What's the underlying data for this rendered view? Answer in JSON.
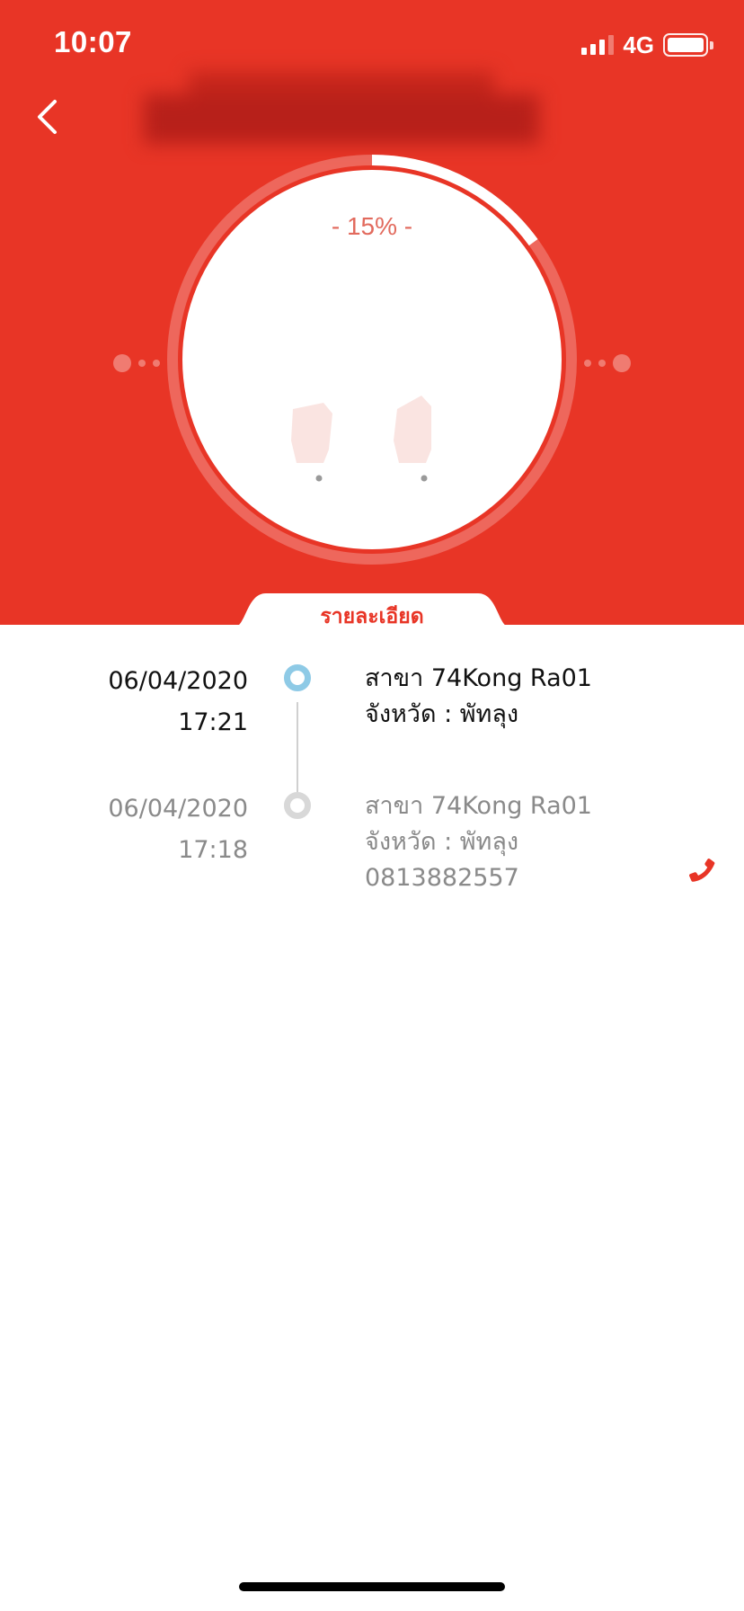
{
  "status_bar": {
    "time": "10:07",
    "network": "4G"
  },
  "header": {
    "background": "#e83526",
    "back_icon": "chevron-left-icon",
    "title_redacted": true
  },
  "progress": {
    "label": "- 15% -",
    "percent": 15,
    "track_color": "rgba(255,255,255,0.25)",
    "fill_color": "#ffffff"
  },
  "details_tab": {
    "label": "รายละเอียด"
  },
  "timeline": [
    {
      "date": "06/04/2020",
      "time": "17:21",
      "branch": "สาขา 74Kong Ra01",
      "province": "จังหวัด : พัทลุง",
      "phone": "",
      "active": true,
      "node_color": "#8ecae6"
    },
    {
      "date": "06/04/2020",
      "time": "17:18",
      "branch": "สาขา 74Kong Ra01",
      "province": "จังหวัด : พัทลุง",
      "phone": "0813882557",
      "active": false,
      "node_color": "#d8d8d8"
    }
  ],
  "call_button": {
    "icon": "phone-icon",
    "color": "#e83526"
  }
}
